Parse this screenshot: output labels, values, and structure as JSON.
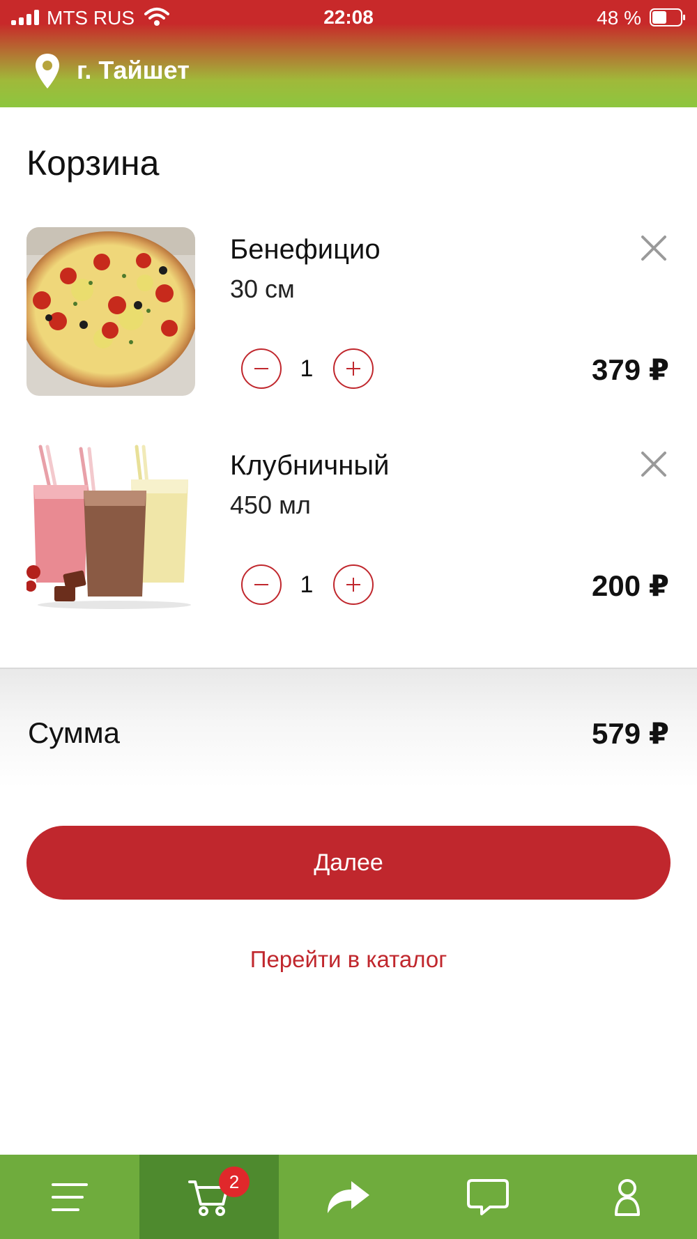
{
  "status_bar": {
    "carrier": "MTS RUS",
    "time": "22:08",
    "battery": "48 %"
  },
  "header": {
    "city": "г. Тайшет",
    "icon": "location-pin-icon"
  },
  "page": {
    "title": "Корзина"
  },
  "cart": {
    "items": [
      {
        "name": "Бенефицио",
        "size": "30 см",
        "quantity": "1",
        "price": "379 ₽",
        "image": "pizza-photo"
      },
      {
        "name": "Клубничный",
        "size": "450 мл",
        "quantity": "1",
        "price": "200 ₽",
        "image": "milkshakes-photo"
      }
    ],
    "sum_label": "Сумма",
    "sum_value": "579 ₽"
  },
  "actions": {
    "next_label": "Далее",
    "catalog_label": "Перейти в каталог"
  },
  "tabbar": {
    "items": [
      {
        "icon": "menu-icon"
      },
      {
        "icon": "cart-icon",
        "badge": "2",
        "active": true
      },
      {
        "icon": "share-icon"
      },
      {
        "icon": "chat-icon"
      },
      {
        "icon": "profile-icon"
      }
    ]
  },
  "colors": {
    "accent": "#c0272d",
    "tabbar": "#6fac3d",
    "tabbar_active": "#4e8a2e",
    "badge": "#e0282b"
  }
}
